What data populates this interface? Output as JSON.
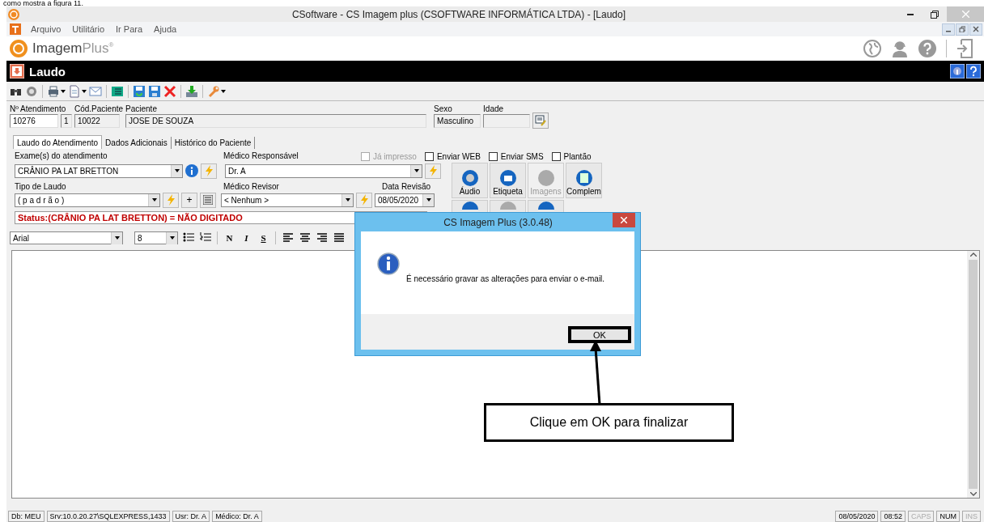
{
  "doc_text": "como mostra a figura 11.",
  "window": {
    "title": "CSoftware - CS Imagem plus (CSOFTWARE INFORMÁTICA LTDA) - [Laudo]"
  },
  "menu": [
    "Arquivo",
    "Utilitário",
    "Ir Para",
    "Ajuda"
  ],
  "logo": {
    "part1": "Imagem",
    "part2": "Plus",
    "mark": "®"
  },
  "form_title": "Laudo",
  "patient_fields": [
    {
      "label": "Nº Atendimento",
      "value": "10276",
      "extra": "1"
    },
    {
      "label": "Cód.Paciente",
      "value": "10022"
    },
    {
      "label": "Paciente",
      "value": "JOSE DE SOUZA"
    },
    {
      "label": "Sexo",
      "value": "Masculino"
    },
    {
      "label": "Idade"
    }
  ],
  "tabs": [
    {
      "label": "Laudo do Atendimento",
      "selected": true
    },
    {
      "label": "Dados Adicionais",
      "selected": false
    },
    {
      "label": "Histórico do Paciente",
      "selected": false
    }
  ],
  "exam": {
    "label": "Exame(s) do atendimento",
    "value": "CRÂNIO PA LAT BRETTON"
  },
  "medico_responsavel": {
    "label": "Médico Responsável",
    "value": "Dr. A"
  },
  "checkboxes": [
    {
      "label": "Já impresso",
      "checked": false,
      "disabled": true
    },
    {
      "label": "Enviar WEB",
      "checked": false,
      "disabled": false
    },
    {
      "label": "Enviar SMS",
      "checked": false,
      "disabled": false
    },
    {
      "label": "Plantão",
      "checked": false,
      "disabled": false
    }
  ],
  "tipo_laudo": {
    "label": "Tipo de Laudo",
    "value": "( p a d r ã o )",
    "add_button": "+"
  },
  "medico_revisor": {
    "label": "Médico Revisor",
    "value": "< Nenhum >"
  },
  "data_revisao": {
    "label": "Data Revisão",
    "value": "08/05/2020"
  },
  "action_buttons": [
    {
      "label": "Áudio",
      "disabled": false
    },
    {
      "label": "Etiqueta",
      "disabled": false
    },
    {
      "label": "Imagens",
      "disabled": true
    },
    {
      "label": "Complem",
      "disabled": false
    }
  ],
  "status": "Status:(CRÂNIO PA LAT BRETTON) = NÃO DIGITADO",
  "editor_toolbar": {
    "font": "Arial",
    "size": "8",
    "format_buttons": [
      "N",
      "I",
      "S"
    ]
  },
  "status_bar": {
    "left": [
      "Db: MEU",
      "Srv:10.0.20.27\\SQLEXPRESS,1433",
      "Usr: Dr. A",
      "Médico: Dr. A"
    ],
    "right": [
      {
        "text": "08/05/2020",
        "on": true
      },
      {
        "text": "08:52",
        "on": true
      },
      {
        "text": "CAPS",
        "on": false
      },
      {
        "text": "NUM",
        "on": true
      },
      {
        "text": "INS",
        "on": false
      }
    ]
  },
  "dialog": {
    "title": "CS Imagem Plus (3.0.48)",
    "message": "É necessário gravar as alterações para enviar o e-mail.",
    "button": "OK"
  },
  "callout": {
    "text": "Clique em OK para finalizar"
  }
}
